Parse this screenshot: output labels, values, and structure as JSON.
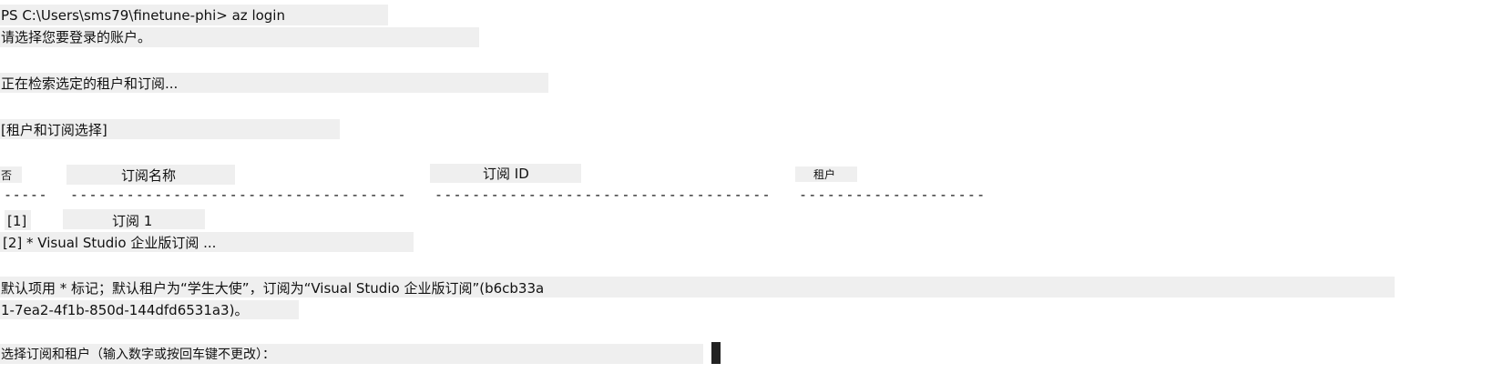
{
  "terminal": {
    "prompt": "PS C:\\Users\\sms79\\finetune-phi> az login",
    "line_choose_account": "请选择您要登录的账户。",
    "line_retrieving": "正在检索选定的租户和订阅...",
    "line_section": "[租户和订阅选择]",
    "table": {
      "col_no": "否",
      "col_name": "订阅名称",
      "col_id": "订阅 ID",
      "col_tenant": "租户",
      "sep_no": "-----",
      "sep_name": "------------------------------------",
      "sep_id": "------------------------------------",
      "sep_tenant": "--------------------",
      "rows": [
        {
          "no": "[1]",
          "name": "订阅 1"
        },
        {
          "full": "[2] * Visual Studio 企业版订阅 ..."
        }
      ]
    },
    "default_line1": "默认项用 * 标记；默认租户为“学生大使”，订阅为“Visual Studio 企业版订阅”(b6cb33a",
    "default_line2": "1-7ea2-4f1b-850d-144dfd6531a3)。",
    "select_prompt": "选择订阅和租户（输入数字或按回车键不更改）："
  }
}
